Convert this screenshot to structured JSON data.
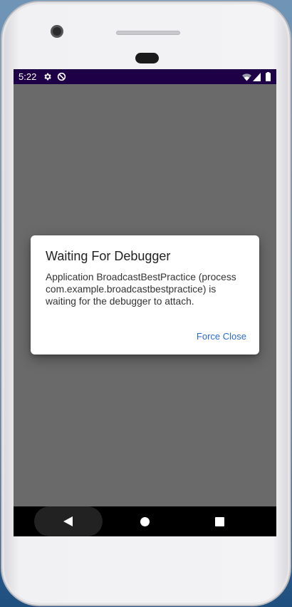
{
  "status_bar": {
    "time": "5:22",
    "icons": [
      "gear-icon",
      "dnd-icon",
      "wifi-icon",
      "signal-icon",
      "battery-icon"
    ]
  },
  "dialog": {
    "title": "Waiting For Debugger",
    "message": "Application BroadcastBestPractice (process com.example.broadcastbestpractice) is waiting for the debugger to attach.",
    "button_label": "Force Close"
  },
  "nav_bar": {
    "icons": [
      "back-icon",
      "home-icon",
      "recents-icon"
    ]
  },
  "colors": {
    "status_bar": "#1e0046",
    "scrim": "#6a6a6a",
    "dialog_background": "#ffffff",
    "accent": "#2a6ad3",
    "nav_bar": "#000000"
  }
}
